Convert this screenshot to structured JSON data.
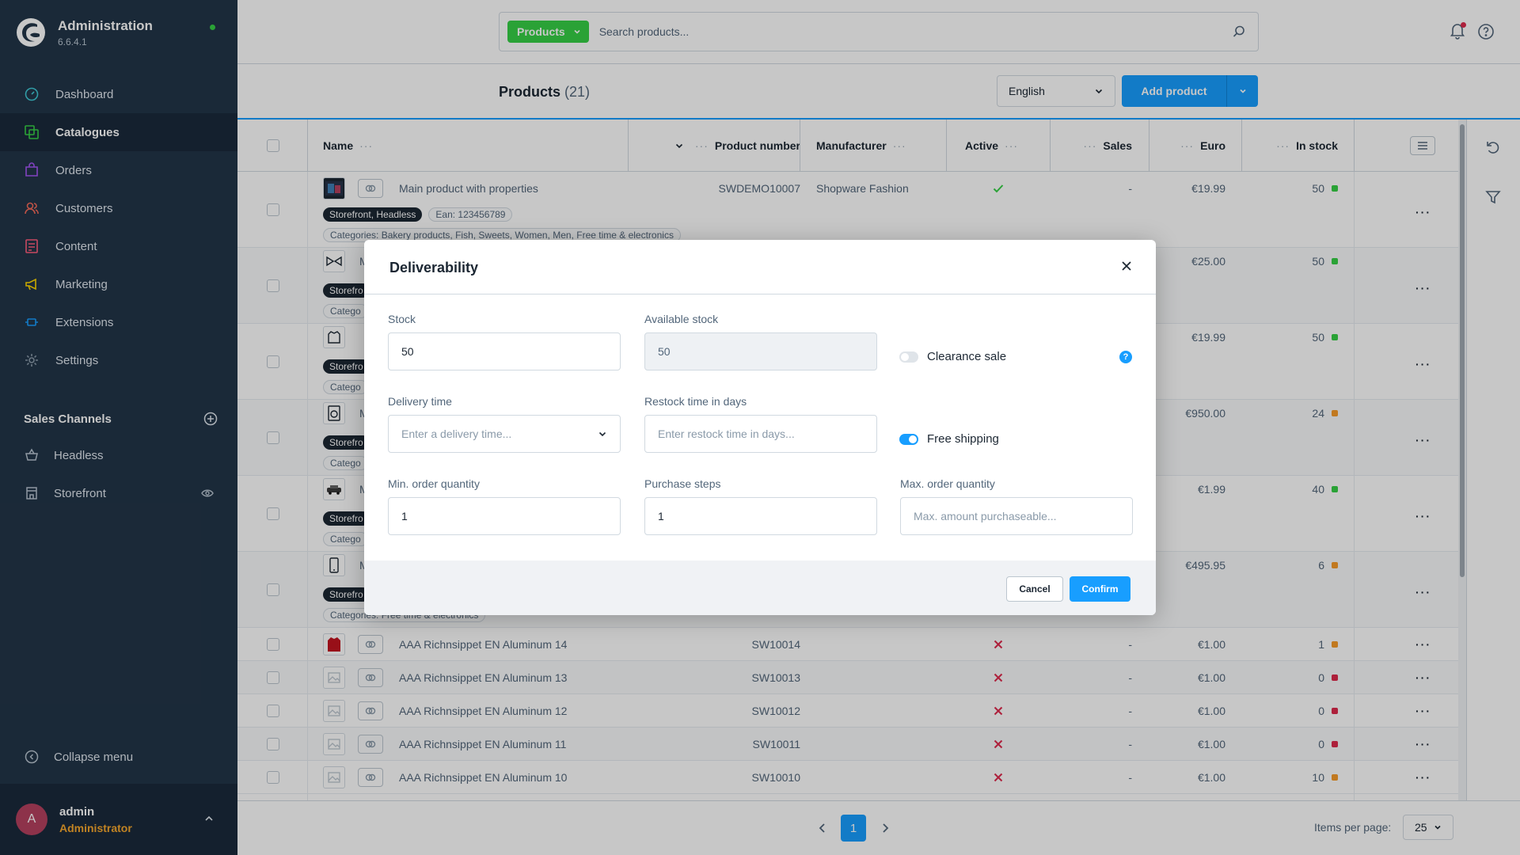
{
  "app": {
    "title": "Administration",
    "version": "6.6.4.1"
  },
  "sidebar": {
    "items": [
      {
        "label": "Dashboard",
        "icon": "dashboard-icon",
        "active": false
      },
      {
        "label": "Catalogues",
        "icon": "catalogue-icon",
        "active": true
      },
      {
        "label": "Orders",
        "icon": "orders-icon",
        "active": false
      },
      {
        "label": "Customers",
        "icon": "customers-icon",
        "active": false
      },
      {
        "label": "Content",
        "icon": "content-icon",
        "active": false
      },
      {
        "label": "Marketing",
        "icon": "marketing-icon",
        "active": false
      },
      {
        "label": "Extensions",
        "icon": "extensions-icon",
        "active": false
      },
      {
        "label": "Settings",
        "icon": "settings-icon",
        "active": false
      }
    ],
    "sales_channels_title": "Sales Channels",
    "sales_channels": [
      {
        "label": "Headless",
        "icon": "basket-icon"
      },
      {
        "label": "Storefront",
        "icon": "storefront-icon"
      }
    ],
    "collapse_label": "Collapse menu",
    "user": {
      "initial": "A",
      "name": "admin",
      "role": "Administrator"
    }
  },
  "search": {
    "type_label": "Products",
    "placeholder": "Search products..."
  },
  "smartbar": {
    "title": "Products",
    "count": "(21)",
    "language": "English",
    "add_button": "Add product"
  },
  "table": {
    "headers": {
      "name": "Name",
      "product_number": "Product number",
      "manufacturer": "Manufacturer",
      "active": "Active",
      "sales": "Sales",
      "euro": "Euro",
      "in_stock": "In stock"
    },
    "first_row": {
      "name": "Main product with properties",
      "number": "SWDEMO10007",
      "manufacturer": "Shopware Fashion",
      "sales": "-",
      "price": "€19.99",
      "stock": "50",
      "badge_channels": "Storefront, Headless",
      "badge_ean": "Ean: 123456789",
      "badge_categories": "Categories: Bakery products, Fish, Sweets, Women, Men, Free time & electronics"
    },
    "partial_rows": [
      {
        "letter": "M",
        "price": "€25.00",
        "stock": "50",
        "stock_color": "#37d046",
        "badge": "Storefro",
        "category": "Catego"
      },
      {
        "letter": "",
        "price": "€19.99",
        "stock": "50",
        "stock_color": "#37d046",
        "badge": "Storefro",
        "category": "Catego"
      },
      {
        "letter": "M",
        "price": "€950.00",
        "stock": "24",
        "stock_color": "#f89b29",
        "badge": "Storefro",
        "category": "Catego"
      },
      {
        "letter": "M",
        "price": "€1.99",
        "stock": "40",
        "stock_color": "#37d046",
        "badge": "Storefro",
        "category": "Catego"
      },
      {
        "letter": "M",
        "price": "€495.95",
        "stock": "6",
        "stock_color": "#f89b29",
        "badge": "Storefro",
        "category": "Categories: Free time & electronics"
      }
    ],
    "rows": [
      {
        "name": "AAA Richnsippet EN Aluminum 14",
        "number": "SW10014",
        "sales": "-",
        "price": "€1.00",
        "stock": "1",
        "stock_color": "#f89b29"
      },
      {
        "name": "AAA Richnsippet EN Aluminum 13",
        "number": "SW10013",
        "sales": "-",
        "price": "€1.00",
        "stock": "0",
        "stock_color": "#de294c"
      },
      {
        "name": "AAA Richnsippet EN Aluminum 12",
        "number": "SW10012",
        "sales": "-",
        "price": "€1.00",
        "stock": "0",
        "stock_color": "#de294c"
      },
      {
        "name": "AAA Richnsippet EN Aluminum 11",
        "number": "SW10011",
        "sales": "-",
        "price": "€1.00",
        "stock": "0",
        "stock_color": "#de294c"
      },
      {
        "name": "AAA Richnsippet EN Aluminum 10",
        "number": "SW10010",
        "sales": "-",
        "price": "€1.00",
        "stock": "10",
        "stock_color": "#f89b29"
      }
    ]
  },
  "pagination": {
    "current_page": "1",
    "items_per_page_label": "Items per page:",
    "items_per_page": "25"
  },
  "modal": {
    "title": "Deliverability",
    "stock_label": "Stock",
    "stock_value": "50",
    "available_stock_label": "Available stock",
    "available_stock_value": "50",
    "clearance_sale_label": "Clearance sale",
    "clearance_sale_on": false,
    "delivery_time_label": "Delivery time",
    "delivery_time_placeholder": "Enter a delivery time...",
    "restock_label": "Restock time in days",
    "restock_placeholder": "Enter restock time in days...",
    "free_shipping_label": "Free shipping",
    "free_shipping_on": true,
    "min_order_label": "Min. order quantity",
    "min_order_value": "1",
    "purchase_steps_label": "Purchase steps",
    "purchase_steps_value": "1",
    "max_order_label": "Max. order quantity",
    "max_order_placeholder": "Max. amount purchaseable...",
    "cancel_label": "Cancel",
    "confirm_label": "Confirm"
  },
  "colors": {
    "accent": "#189eff",
    "sidebar_bg": "#223548",
    "search_type": "#37d046",
    "danger": "#de294c",
    "warning": "#f89b29",
    "success": "#37d046"
  }
}
